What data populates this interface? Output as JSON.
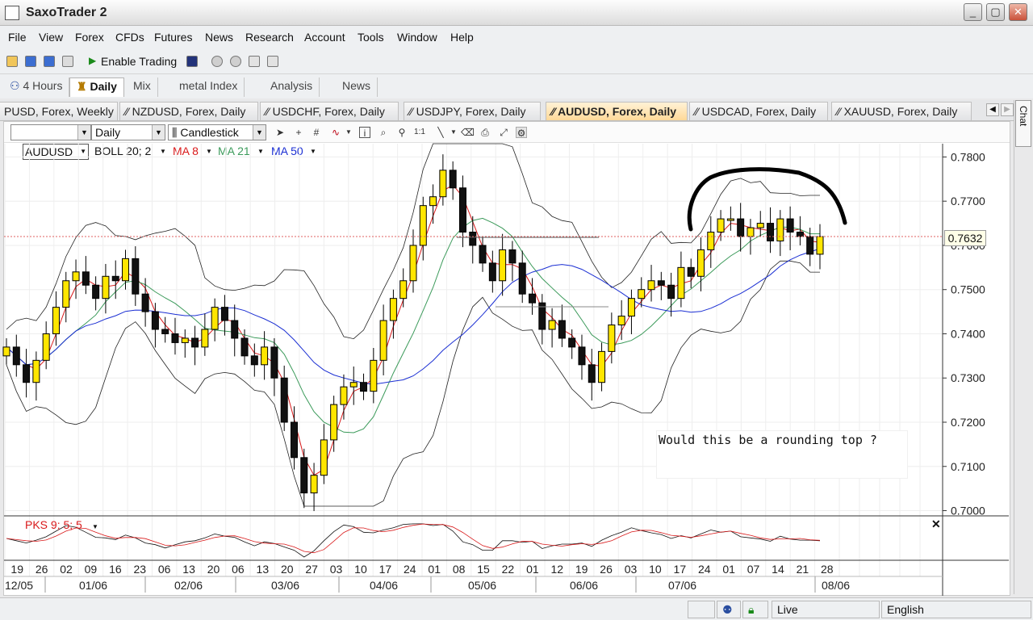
{
  "window": {
    "title": "SaxoTrader 2",
    "min": "_",
    "max": "▢",
    "close": "✕"
  },
  "menu": [
    "File",
    "View",
    "Forex",
    "CFDs",
    "Futures",
    "News",
    "Research",
    "Account",
    "Tools",
    "Window",
    "Help"
  ],
  "toolbar": {
    "enable_trading": "Enable Trading"
  },
  "workspace_tabs": [
    "4 Hours",
    "Daily",
    "Mix",
    "metal Index",
    "Analysis",
    "News"
  ],
  "workspace_active": "Daily",
  "chart_tabs": [
    "PUSD, Forex, Weekly",
    "NZDUSD, Forex, Daily",
    "USDCHF, Forex, Daily",
    "USDJPY, Forex, Daily",
    "AUDUSD, Forex, Daily",
    "USDCAD, Forex, Daily",
    "XAUUSD, Forex, Daily"
  ],
  "chart_tab_active": "AUDUSD, Forex, Daily",
  "chat_label": "Chat",
  "chart_toolbar": {
    "period": "Daily",
    "style": "Candlestick"
  },
  "legend": {
    "instrument": "AUDUSD",
    "boll": "BOLL 20; 2",
    "ma8": "MA 8",
    "ma21": "MA 21",
    "ma50": "MA 50"
  },
  "indicator_label": "PKS 9; 5; 5",
  "current_price": "0.7632",
  "annotation": "Would this be a rounding top ?",
  "colors": {
    "ma8": "#d9191a",
    "ma21": "#3b9a5a",
    "ma50": "#1b2fd3",
    "boll": "#222222",
    "candle_up": "#ffe600",
    "candle_body_edge": "#000000"
  },
  "chart_data": {
    "type": "candlestick",
    "instrument": "AUDUSD",
    "period": "Daily",
    "y_ticks": [
      "0.7800",
      "0.7700",
      "0.7600",
      "0.7500",
      "0.7400",
      "0.7300",
      "0.7200",
      "0.7100",
      "0.7000"
    ],
    "y_range": [
      0.699,
      0.783
    ],
    "x_day_labels": [
      "19",
      "26",
      "02",
      "09",
      "16",
      "23",
      "06",
      "13",
      "20",
      "06",
      "13",
      "20",
      "27",
      "03",
      "10",
      "17",
      "24",
      "01",
      "08",
      "15",
      "22",
      "01",
      "12",
      "19",
      "26",
      "03",
      "10",
      "17",
      "24",
      "01",
      "07",
      "14",
      "21",
      "28"
    ],
    "x_month_labels": [
      "12/05",
      "01/06",
      "02/06",
      "03/06",
      "04/06",
      "05/06",
      "06/06",
      "07/06",
      "08/06"
    ],
    "close_series": [
      0.737,
      0.733,
      0.729,
      0.734,
      0.74,
      0.746,
      0.752,
      0.754,
      0.751,
      0.748,
      0.753,
      0.752,
      0.757,
      0.749,
      0.745,
      0.741,
      0.74,
      0.738,
      0.739,
      0.737,
      0.741,
      0.746,
      0.743,
      0.739,
      0.735,
      0.733,
      0.737,
      0.73,
      0.72,
      0.712,
      0.704,
      0.708,
      0.716,
      0.724,
      0.728,
      0.729,
      0.727,
      0.734,
      0.743,
      0.748,
      0.752,
      0.76,
      0.769,
      0.771,
      0.777,
      0.773,
      0.763,
      0.76,
      0.756,
      0.752,
      0.759,
      0.756,
      0.749,
      0.747,
      0.741,
      0.743,
      0.739,
      0.737,
      0.733,
      0.729,
      0.736,
      0.742,
      0.744,
      0.748,
      0.75,
      0.752,
      0.751,
      0.748,
      0.755,
      0.753,
      0.759,
      0.763,
      0.766,
      0.766,
      0.762,
      0.764,
      0.765,
      0.761,
      0.766,
      0.763,
      0.762,
      0.758,
      0.762
    ],
    "annotations": [
      "Would this be a rounding top ?"
    ]
  },
  "status": {
    "mode": "Live",
    "language": "English"
  }
}
